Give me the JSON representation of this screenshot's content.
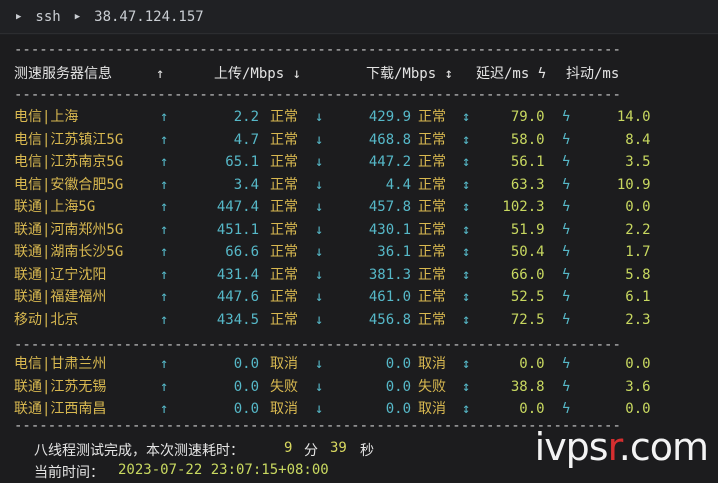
{
  "window": {
    "breadcrumb": [
      "ssh",
      "38.47.124.157"
    ]
  },
  "header": {
    "col_server": "测速服务器信息",
    "col_server_arrow": "↑",
    "col_upload": "上传/Mbps ↓",
    "col_download": "下载/Mbps ↕",
    "col_latency": "延迟/ms ϟ",
    "col_jitter": "抖动/ms"
  },
  "rows": [
    {
      "isp": "电信|上海",
      "up": "2.2",
      "up_status": "正常",
      "down": "429.9",
      "down_status": "正常",
      "latency": "79.0",
      "jitter": "14.0"
    },
    {
      "isp": "电信|江苏镇江5G",
      "up": "4.7",
      "up_status": "正常",
      "down": "468.8",
      "down_status": "正常",
      "latency": "58.0",
      "jitter": "8.4"
    },
    {
      "isp": "电信|江苏南京5G",
      "up": "65.1",
      "up_status": "正常",
      "down": "447.2",
      "down_status": "正常",
      "latency": "56.1",
      "jitter": "3.5"
    },
    {
      "isp": "电信|安徽合肥5G",
      "up": "3.4",
      "up_status": "正常",
      "down": "4.4",
      "down_status": "正常",
      "latency": "63.3",
      "jitter": "10.9"
    },
    {
      "isp": "联通|上海5G",
      "up": "447.4",
      "up_status": "正常",
      "down": "457.8",
      "down_status": "正常",
      "latency": "102.3",
      "jitter": "0.0"
    },
    {
      "isp": "联通|河南郑州5G",
      "up": "451.1",
      "up_status": "正常",
      "down": "430.1",
      "down_status": "正常",
      "latency": "51.9",
      "jitter": "2.2"
    },
    {
      "isp": "联通|湖南长沙5G",
      "up": "66.6",
      "up_status": "正常",
      "down": "36.1",
      "down_status": "正常",
      "latency": "50.4",
      "jitter": "1.7"
    },
    {
      "isp": "联通|辽宁沈阳",
      "up": "431.4",
      "up_status": "正常",
      "down": "381.3",
      "down_status": "正常",
      "latency": "66.0",
      "jitter": "5.8"
    },
    {
      "isp": "联通|福建福州",
      "up": "447.6",
      "up_status": "正常",
      "down": "461.0",
      "down_status": "正常",
      "latency": "52.5",
      "jitter": "6.1"
    },
    {
      "isp": "移动|北京",
      "up": "434.5",
      "up_status": "正常",
      "down": "456.8",
      "down_status": "正常",
      "latency": "72.5",
      "jitter": "2.3"
    }
  ],
  "rows2": [
    {
      "isp": "电信|甘肃兰州",
      "up": "0.0",
      "up_status": "取消",
      "down": "0.0",
      "down_status": "取消",
      "latency": "0.0",
      "jitter": "0.0"
    },
    {
      "isp": "联通|江苏无锡",
      "up": "0.0",
      "up_status": "失败",
      "down": "0.0",
      "down_status": "失败",
      "latency": "38.8",
      "jitter": "3.6"
    },
    {
      "isp": "联通|江西南昌",
      "up": "0.0",
      "up_status": "取消",
      "down": "0.0",
      "down_status": "取消",
      "latency": "0.0",
      "jitter": "0.0"
    }
  ],
  "glyphs": {
    "up": "↑",
    "down": "↓",
    "updown": "↕",
    "bolt": "ϟ"
  },
  "footer": {
    "line1_prefix": "八线程测试完成，本次测速耗时：",
    "minutes": "9",
    "min_unit": "分",
    "seconds": "39",
    "sec_unit": "秒",
    "line2_prefix": "当前时间：",
    "time": "2023-07-22 23:07:15+08:00"
  },
  "dash_line": "------------------------------------------------------------------------",
  "watermark": {
    "a": "ivps",
    "b": "r",
    "c": ".com"
  }
}
